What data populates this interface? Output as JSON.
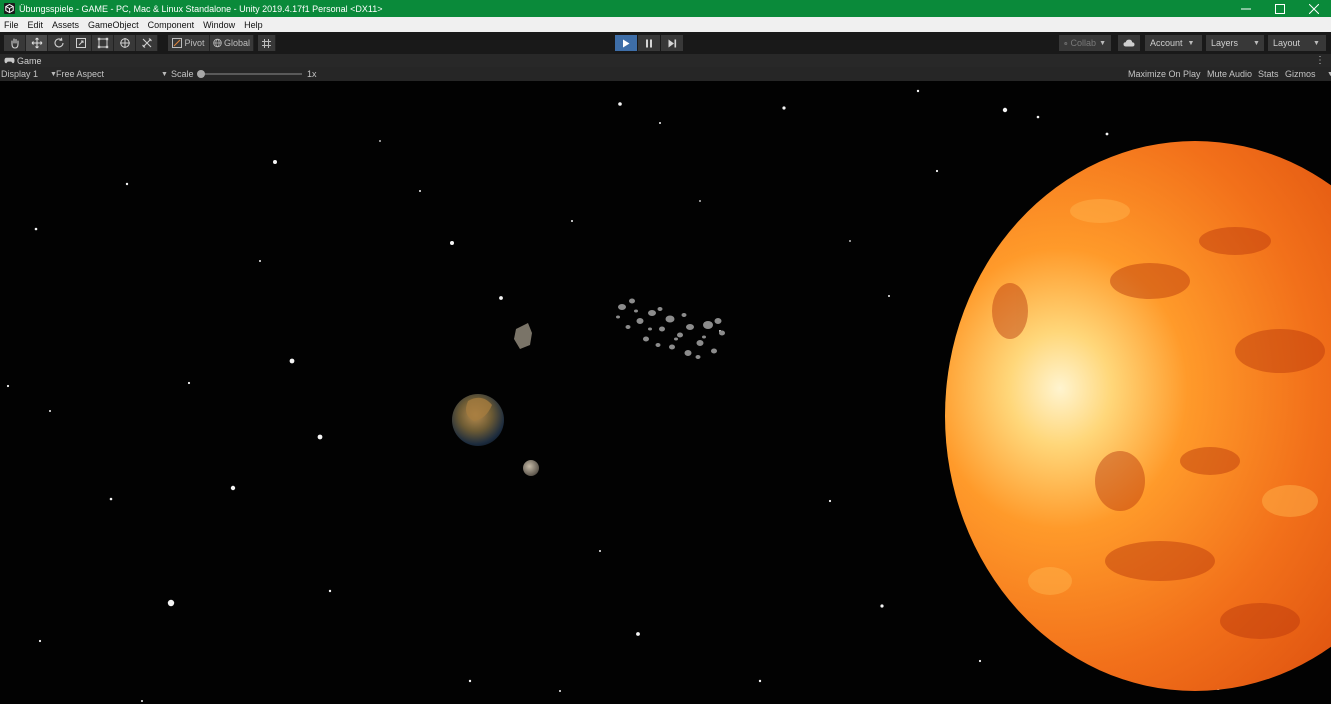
{
  "window": {
    "title": "Übungsspiele - GAME - PC, Mac & Linux Standalone - Unity 2019.4.17f1 Personal <DX11>",
    "controls": [
      "minimize-icon",
      "maximize-icon",
      "close-icon"
    ]
  },
  "menu": {
    "items": [
      "File",
      "Edit",
      "Assets",
      "GameObject",
      "Component",
      "Window",
      "Help"
    ]
  },
  "toolbar": {
    "tools": [
      "hand-icon",
      "move-icon",
      "rotate-icon",
      "scale-icon",
      "rect-tool-icon",
      "transform-icon",
      "custom-tool-icon"
    ],
    "pivot_label": "Pivot",
    "global_label": "Global",
    "playback": [
      "play-icon",
      "pause-icon",
      "step-icon"
    ],
    "collab_label": "Collab",
    "account_label": "Account",
    "layers_label": "Layers",
    "layout_label": "Layout"
  },
  "game_view": {
    "tab_label": "Game",
    "display_label": "Display 1",
    "aspect_label": "Free Aspect",
    "scale_label": "Scale",
    "scale_value": "1x",
    "maximize_label": "Maximize On Play",
    "mute_label": "Mute Audio",
    "stats_label": "Stats",
    "gizmos_label": "Gizmos"
  },
  "colors": {
    "titlebar": "#0a8a3a",
    "play_active": "#3e6ea8",
    "sun_core": "#ffe9b0",
    "sun_edge": "#d9480a"
  }
}
